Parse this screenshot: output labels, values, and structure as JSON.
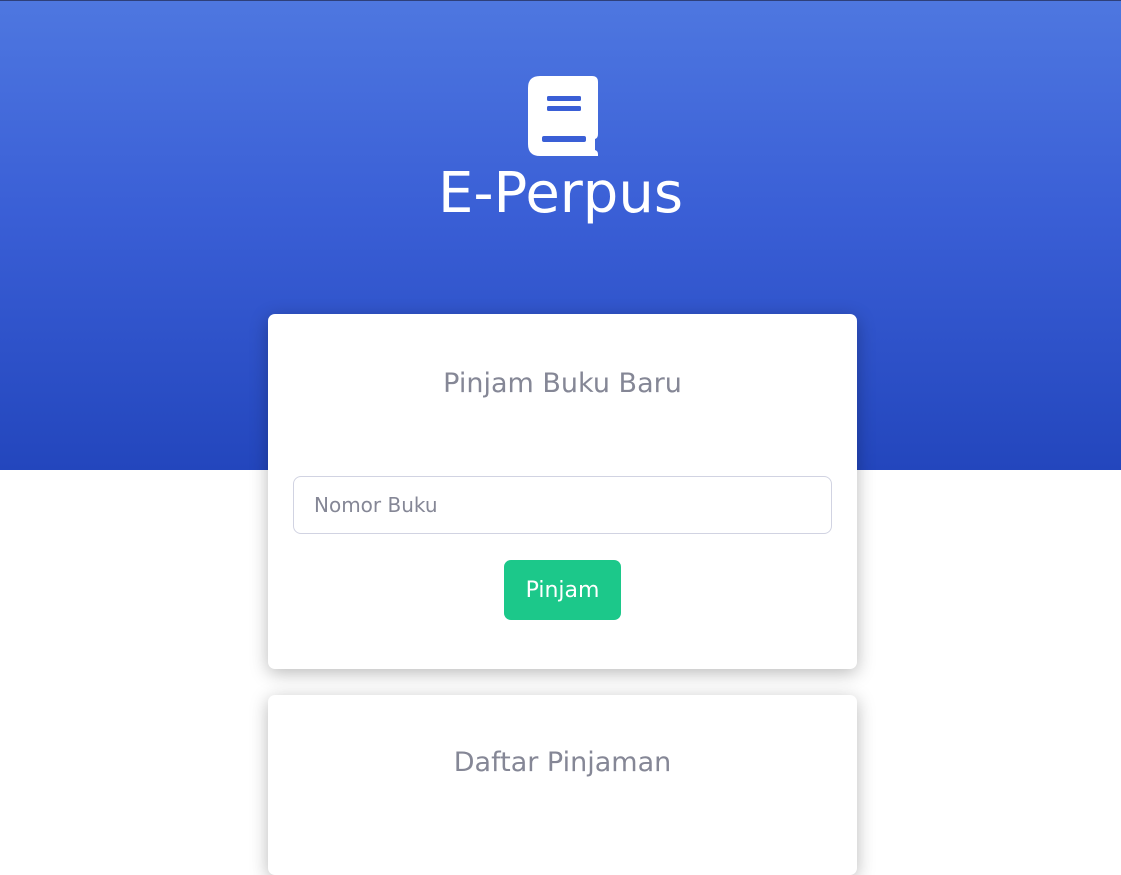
{
  "header": {
    "logo_icon": "book-icon",
    "app_title": "E-Perpus"
  },
  "borrow_card": {
    "title": "Pinjam Buku Baru",
    "book_number_placeholder": "Nomor Buku",
    "book_number_value": "",
    "submit_label": "Pinjam"
  },
  "loans_card": {
    "title": "Daftar Pinjaman"
  },
  "colors": {
    "header_gradient_top": "#4e77e0",
    "header_gradient_bottom": "#2346bd",
    "success": "#1cc88a",
    "muted_text": "#858796"
  }
}
